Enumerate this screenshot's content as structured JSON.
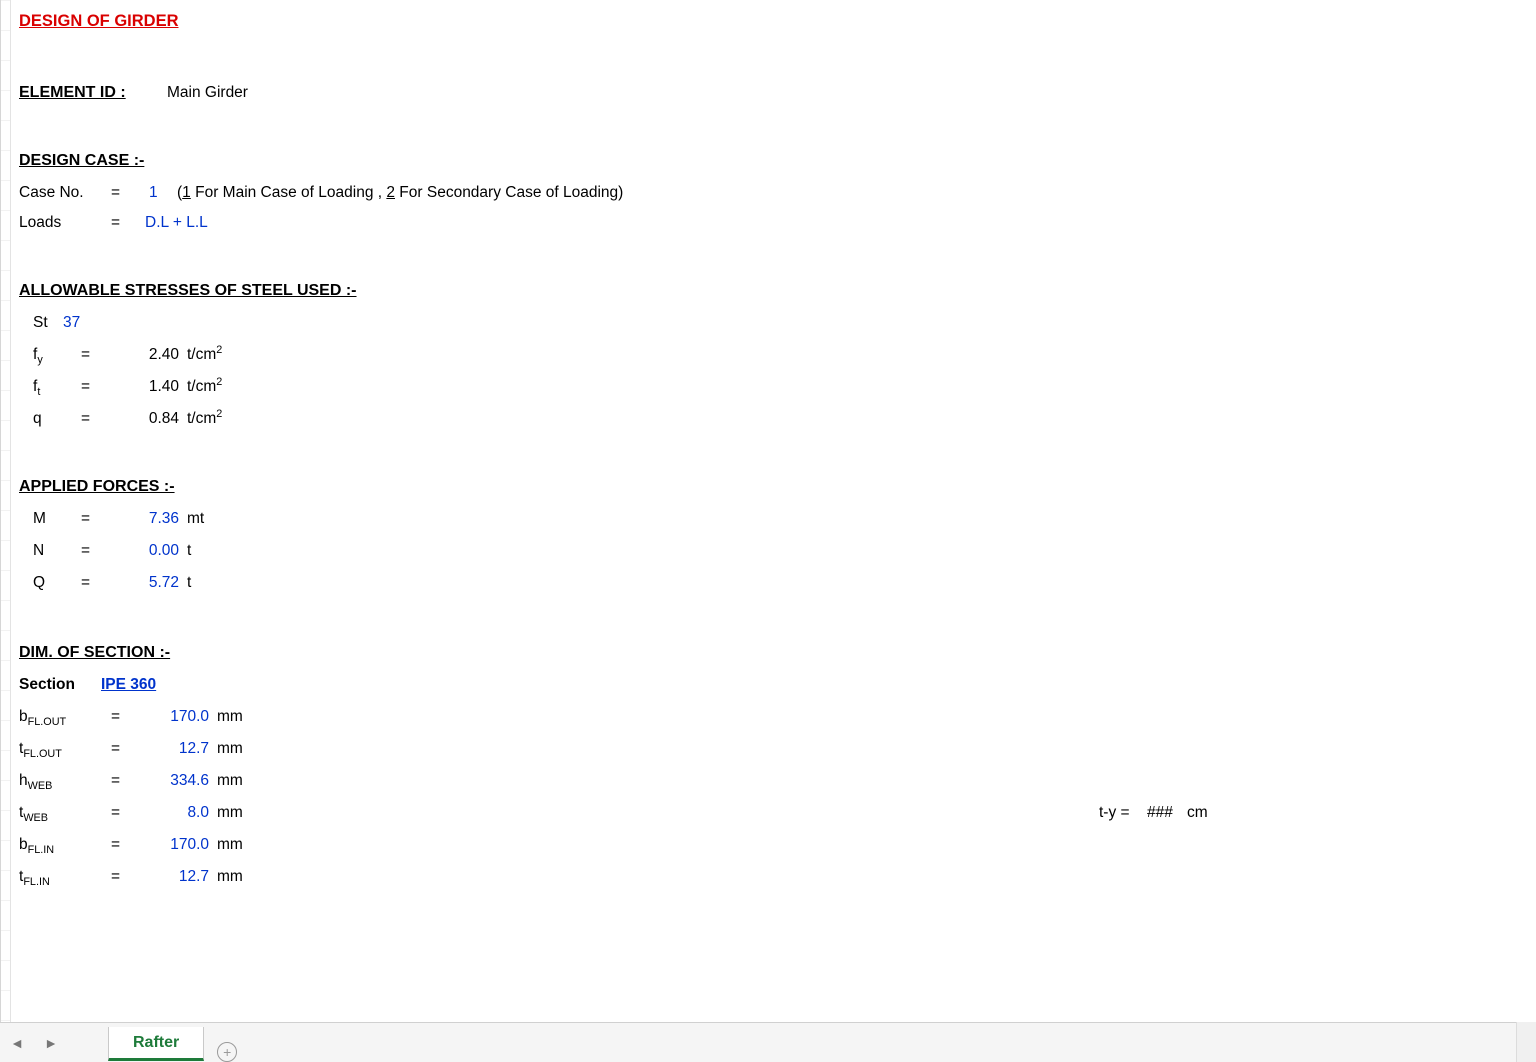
{
  "title": "DESIGN OF GIRDER",
  "element_id": {
    "label": "ELEMENT ID :",
    "value": "Main Girder"
  },
  "design_case": {
    "header": "DESIGN CASE :-",
    "case_no_label": "Case No.",
    "eq": "=",
    "case_no_value": "1",
    "case_note_open": "(",
    "case_note_1": "1",
    "case_note_mid": " For Main Case of Loading , ",
    "case_note_2": "2",
    "case_note_end": " For Secondary Case of Loading)",
    "loads_label": "Loads",
    "loads_value": "D.L + L.L"
  },
  "allow": {
    "header": "ALLOWABLE STRESSES OF STEEL USED :-",
    "st_label": "St",
    "st_value": "37",
    "fy": {
      "sym": "f",
      "sub": "y",
      "val": "2.40",
      "unit_pre": "t/cm",
      "unit_sup": "2"
    },
    "ft": {
      "sym": "f",
      "sub": "t",
      "val": "1.40",
      "unit_pre": "t/cm",
      "unit_sup": "2"
    },
    "q": {
      "sym": "q",
      "val": "0.84",
      "unit_pre": "t/cm",
      "unit_sup": "2"
    }
  },
  "forces": {
    "header": "APPLIED FORCES :-",
    "M": {
      "sym": "M",
      "val": "7.36",
      "unit": "mt"
    },
    "N": {
      "sym": "N",
      "val": "0.00",
      "unit": "t"
    },
    "Q": {
      "sym": "Q",
      "val": "5.72",
      "unit": "t"
    }
  },
  "dim": {
    "header": "DIM. OF SECTION :-",
    "sect_label": "Section",
    "sect_value": "IPE 360",
    "rows": {
      "b_fl_out": {
        "label": "b",
        "sub": "FL.OUT",
        "val": "170.0",
        "unit": "mm"
      },
      "t_fl_out": {
        "label": "t",
        "sub": "FL.OUT",
        "val": "12.7",
        "unit": "mm"
      },
      "h_web": {
        "label": "h",
        "sub": "WEB",
        "val": "334.6",
        "unit": "mm"
      },
      "t_web": {
        "label": "t",
        "sub": "WEB",
        "val": "8.0",
        "unit": "mm"
      },
      "b_fl_in": {
        "label": "b",
        "sub": "FL.IN",
        "val": "170.0",
        "unit": "mm"
      },
      "t_fl_in": {
        "label": "t",
        "sub": "FL.IN",
        "val": "12.7",
        "unit": "mm"
      }
    },
    "ty": {
      "label": "t-y =",
      "val": "###",
      "unit": "cm"
    }
  },
  "tabs": {
    "active": "Rafter"
  },
  "sym": {
    "eq": "="
  }
}
